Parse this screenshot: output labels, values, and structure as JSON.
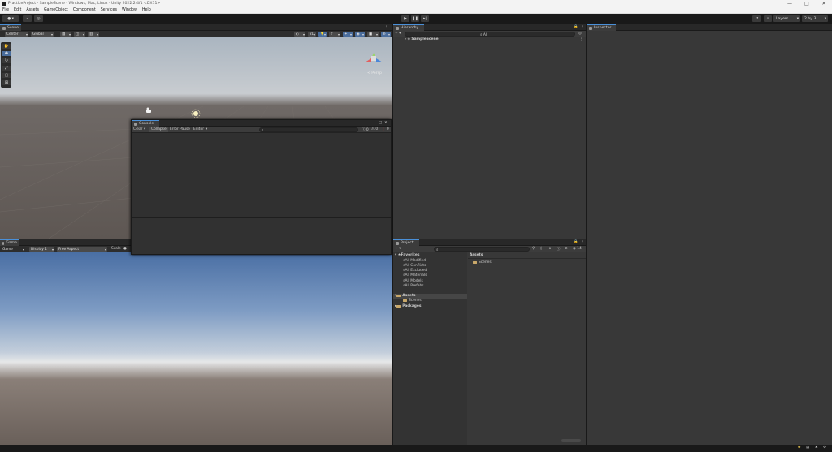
{
  "window": {
    "title": "PracticeProject - SampleScene - Windows, Mac, Linux - Unity 2022.2.4f1 <DX11>"
  },
  "menu": [
    "File",
    "Edit",
    "Assets",
    "GameObject",
    "Component",
    "Services",
    "Window",
    "Help"
  ],
  "toolbar": {
    "play": "play-icon",
    "pause": "pause-icon",
    "step": "step-icon",
    "layers": "Layers",
    "layout": "2 by 3"
  },
  "scene": {
    "tab": "Scene",
    "pivot": "Center",
    "space": "Global",
    "persp_label": "< Persp"
  },
  "game": {
    "tab": "Game",
    "mode": "Game",
    "display": "Display 1",
    "aspect": "Free Aspect",
    "scale": "Scale"
  },
  "console": {
    "tab": "Console",
    "clear": "Clear",
    "collapse": "Collapse",
    "error_pause": "Error Pause",
    "editor": "Editor",
    "counts": [
      "0",
      "0",
      "0"
    ]
  },
  "hierarchy": {
    "tab": "Hierarchy",
    "scene_name": "SampleScene",
    "search_label": "All"
  },
  "inspector": {
    "tab": "Inspector"
  },
  "project": {
    "tab": "Project",
    "favorites_label": "Favorites",
    "favorites": [
      "All Modified",
      "All Conflicts",
      "All Excluded",
      "All Materials",
      "All Models",
      "All Prefabs"
    ],
    "assets_label": "Assets",
    "assets_children": [
      "Scenes"
    ],
    "packages_label": "Packages",
    "breadcrumb": "Assets",
    "grid_items": [
      "Scenes"
    ],
    "hidden_count": "14"
  },
  "colors": {
    "accent": "#4a90d9",
    "panel": "#383838",
    "dark": "#191919"
  }
}
